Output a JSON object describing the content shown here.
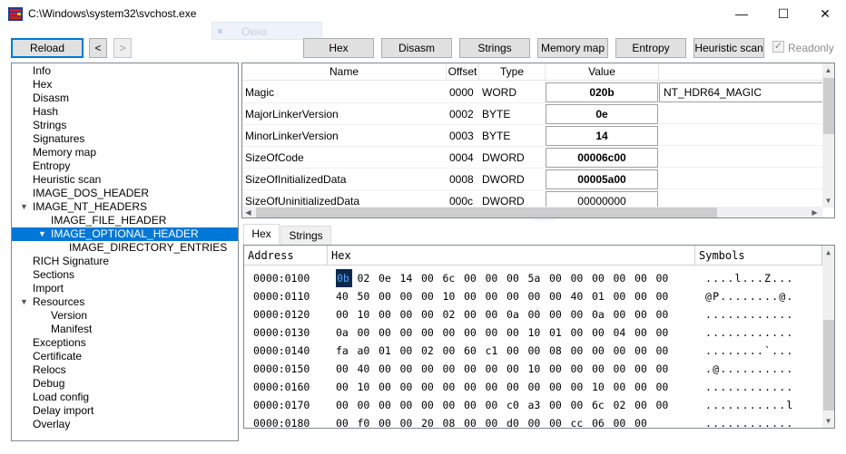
{
  "window": {
    "title": "C:\\Windows\\system32\\svchost.exe",
    "ghost_tooltip": "Окно",
    "minimize_glyph": "—",
    "maximize_glyph": "☐",
    "close_glyph": "✕"
  },
  "toolbar": {
    "reload": "Reload",
    "back": "<",
    "forward": ">",
    "hex": "Hex",
    "disasm": "Disasm",
    "strings": "Strings",
    "memory_map": "Memory map",
    "entropy": "Entropy",
    "heuristic_scan": "Heuristic scan",
    "readonly_label": "Readonly",
    "readonly_checked": "✓"
  },
  "tree": {
    "items": [
      {
        "label": "Info",
        "level": 0
      },
      {
        "label": "Hex",
        "level": 0
      },
      {
        "label": "Disasm",
        "level": 0
      },
      {
        "label": "Hash",
        "level": 0
      },
      {
        "label": "Strings",
        "level": 0
      },
      {
        "label": "Signatures",
        "level": 0
      },
      {
        "label": "Memory map",
        "level": 0
      },
      {
        "label": "Entropy",
        "level": 0
      },
      {
        "label": "Heuristic scan",
        "level": 0
      },
      {
        "label": "IMAGE_DOS_HEADER",
        "level": 0
      },
      {
        "label": "IMAGE_NT_HEADERS",
        "level": 0,
        "expanded": true
      },
      {
        "label": "IMAGE_FILE_HEADER",
        "level": 1
      },
      {
        "label": "IMAGE_OPTIONAL_HEADER",
        "level": 1,
        "expanded": true,
        "selected": true
      },
      {
        "label": "IMAGE_DIRECTORY_ENTRIES",
        "level": 2
      },
      {
        "label": "RICH Signature",
        "level": 0
      },
      {
        "label": "Sections",
        "level": 0
      },
      {
        "label": "Import",
        "level": 0
      },
      {
        "label": "Resources",
        "level": 0,
        "expanded": true
      },
      {
        "label": "Version",
        "level": 1
      },
      {
        "label": "Manifest",
        "level": 1
      },
      {
        "label": "Exceptions",
        "level": 0
      },
      {
        "label": "Certificate",
        "level": 0
      },
      {
        "label": "Relocs",
        "level": 0
      },
      {
        "label": "Debug",
        "level": 0
      },
      {
        "label": "Load config",
        "level": 0
      },
      {
        "label": "Delay import",
        "level": 0
      },
      {
        "label": "Overlay",
        "level": 0
      }
    ]
  },
  "fields": {
    "headers": {
      "name": "Name",
      "offset": "Offset",
      "type": "Type",
      "value": "Value"
    },
    "rows": [
      {
        "name": "Magic",
        "offset": "0000",
        "type": "WORD",
        "value": "020b",
        "comment": "NT_HDR64_MAGIC"
      },
      {
        "name": "MajorLinkerVersion",
        "offset": "0002",
        "type": "BYTE",
        "value": "0e",
        "comment": ""
      },
      {
        "name": "MinorLinkerVersion",
        "offset": "0003",
        "type": "BYTE",
        "value": "14",
        "comment": ""
      },
      {
        "name": "SizeOfCode",
        "offset": "0004",
        "type": "DWORD",
        "value": "00006c00",
        "comment": ""
      },
      {
        "name": "SizeOfInitializedData",
        "offset": "0008",
        "type": "DWORD",
        "value": "00005a00",
        "comment": ""
      },
      {
        "name": "SizeOfUninitializedData",
        "offset": "000c",
        "type": "DWORD",
        "value": "00000000",
        "comment": ""
      }
    ]
  },
  "tabs": [
    {
      "label": "Hex",
      "active": true
    },
    {
      "label": "Strings",
      "active": false
    }
  ],
  "hexview": {
    "headers": {
      "address": "Address",
      "hex": "Hex",
      "symbols": "Symbols"
    },
    "rows": [
      {
        "address": "0000:0100",
        "bytes": [
          "0b",
          "02",
          "0e",
          "14",
          "00",
          "6c",
          "00",
          "00",
          "00",
          "5a",
          "00",
          "00",
          "00",
          "00",
          "00",
          "00"
        ],
        "symbols": "....l...Z..."
      },
      {
        "address": "0000:0110",
        "bytes": [
          "40",
          "50",
          "00",
          "00",
          "00",
          "10",
          "00",
          "00",
          "00",
          "00",
          "00",
          "40",
          "01",
          "00",
          "00",
          "00"
        ],
        "symbols": "@P........@."
      },
      {
        "address": "0000:0120",
        "bytes": [
          "00",
          "10",
          "00",
          "00",
          "00",
          "02",
          "00",
          "00",
          "0a",
          "00",
          "00",
          "00",
          "0a",
          "00",
          "00",
          "00"
        ],
        "symbols": "............"
      },
      {
        "address": "0000:0130",
        "bytes": [
          "0a",
          "00",
          "00",
          "00",
          "00",
          "00",
          "00",
          "00",
          "00",
          "10",
          "01",
          "00",
          "00",
          "04",
          "00",
          "00"
        ],
        "symbols": "............"
      },
      {
        "address": "0000:0140",
        "bytes": [
          "fa",
          "a0",
          "01",
          "00",
          "02",
          "00",
          "60",
          "c1",
          "00",
          "00",
          "08",
          "00",
          "00",
          "00",
          "00",
          "00"
        ],
        "symbols": "........`..."
      },
      {
        "address": "0000:0150",
        "bytes": [
          "00",
          "40",
          "00",
          "00",
          "00",
          "00",
          "00",
          "00",
          "00",
          "10",
          "00",
          "00",
          "00",
          "00",
          "00",
          "00"
        ],
        "symbols": ".@.........."
      },
      {
        "address": "0000:0160",
        "bytes": [
          "00",
          "10",
          "00",
          "00",
          "00",
          "00",
          "00",
          "00",
          "00",
          "00",
          "00",
          "00",
          "10",
          "00",
          "00",
          "00"
        ],
        "symbols": "............"
      },
      {
        "address": "0000:0170",
        "bytes": [
          "00",
          "00",
          "00",
          "00",
          "00",
          "00",
          "00",
          "00",
          "c0",
          "a3",
          "00",
          "00",
          "6c",
          "02",
          "00",
          "00"
        ],
        "symbols": "...........l"
      },
      {
        "address": "0000:0180",
        "bytes": [
          "00",
          "f0",
          "00",
          "00",
          "20",
          "08",
          "00",
          "00",
          "d0",
          "00",
          "00",
          "cc",
          "06",
          "00",
          "00"
        ],
        "symbols": "............"
      }
    ]
  },
  "colors": {
    "selection": "#0078d7",
    "hex_cursor_bg": "#0b2a4a",
    "hex_cursor_fg": "#5aa0ff",
    "app_icon_red": "#d22020",
    "app_icon_blue": "#1d3a8a"
  }
}
